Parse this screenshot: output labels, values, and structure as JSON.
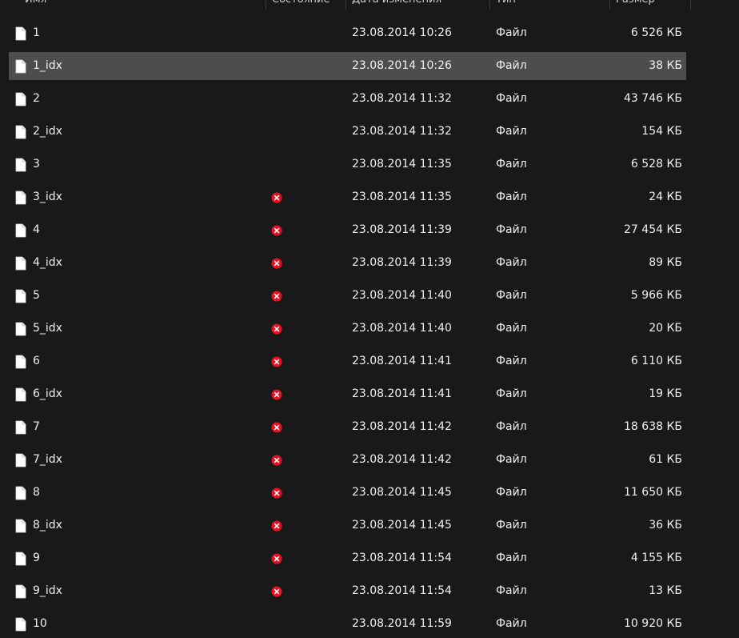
{
  "header": {
    "name": "Имя",
    "status": "Состояние",
    "date": "Дата изменения",
    "type": "Тип",
    "size": "Размер"
  },
  "colors": {
    "background": "#191919",
    "selected_row": "#4d4d4d",
    "error_red": "#e81123"
  },
  "files": [
    {
      "name": "1",
      "status": "",
      "date": "23.08.2014 10:26",
      "type": "Файл",
      "size": "6 526 КБ",
      "selected": false
    },
    {
      "name": "1_idx",
      "status": "",
      "date": "23.08.2014 10:26",
      "type": "Файл",
      "size": "38 КБ",
      "selected": true
    },
    {
      "name": "2",
      "status": "",
      "date": "23.08.2014 11:32",
      "type": "Файл",
      "size": "43 746 КБ",
      "selected": false
    },
    {
      "name": "2_idx",
      "status": "",
      "date": "23.08.2014 11:32",
      "type": "Файл",
      "size": "154 КБ",
      "selected": false
    },
    {
      "name": "3",
      "status": "",
      "date": "23.08.2014 11:35",
      "type": "Файл",
      "size": "6 528 КБ",
      "selected": false
    },
    {
      "name": "3_idx",
      "status": "error",
      "date": "23.08.2014 11:35",
      "type": "Файл",
      "size": "24 КБ",
      "selected": false
    },
    {
      "name": "4",
      "status": "error",
      "date": "23.08.2014 11:39",
      "type": "Файл",
      "size": "27 454 КБ",
      "selected": false
    },
    {
      "name": "4_idx",
      "status": "error",
      "date": "23.08.2014 11:39",
      "type": "Файл",
      "size": "89 КБ",
      "selected": false
    },
    {
      "name": "5",
      "status": "error",
      "date": "23.08.2014 11:40",
      "type": "Файл",
      "size": "5 966 КБ",
      "selected": false
    },
    {
      "name": "5_idx",
      "status": "error",
      "date": "23.08.2014 11:40",
      "type": "Файл",
      "size": "20 КБ",
      "selected": false
    },
    {
      "name": "6",
      "status": "error",
      "date": "23.08.2014 11:41",
      "type": "Файл",
      "size": "6 110 КБ",
      "selected": false
    },
    {
      "name": "6_idx",
      "status": "error",
      "date": "23.08.2014 11:41",
      "type": "Файл",
      "size": "19 КБ",
      "selected": false
    },
    {
      "name": "7",
      "status": "error",
      "date": "23.08.2014 11:42",
      "type": "Файл",
      "size": "18 638 КБ",
      "selected": false
    },
    {
      "name": "7_idx",
      "status": "error",
      "date": "23.08.2014 11:42",
      "type": "Файл",
      "size": "61 КБ",
      "selected": false
    },
    {
      "name": "8",
      "status": "error",
      "date": "23.08.2014 11:45",
      "type": "Файл",
      "size": "11 650 КБ",
      "selected": false
    },
    {
      "name": "8_idx",
      "status": "error",
      "date": "23.08.2014 11:45",
      "type": "Файл",
      "size": "36 КБ",
      "selected": false
    },
    {
      "name": "9",
      "status": "error",
      "date": "23.08.2014 11:54",
      "type": "Файл",
      "size": "4 155 КБ",
      "selected": false
    },
    {
      "name": "9_idx",
      "status": "error",
      "date": "23.08.2014 11:54",
      "type": "Файл",
      "size": "13 КБ",
      "selected": false
    },
    {
      "name": "10",
      "status": "",
      "date": "23.08.2014 11:59",
      "type": "Файл",
      "size": "10 920 КБ",
      "selected": false
    }
  ]
}
